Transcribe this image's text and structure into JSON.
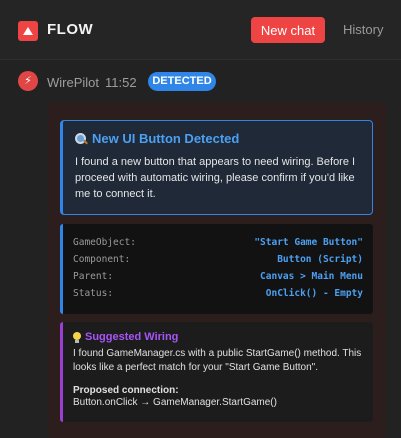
{
  "header": {
    "app_title": "FLOW",
    "new_chat_label": "New chat",
    "history_label": "History",
    "accent_color": "#ef4444"
  },
  "message": {
    "sender": "WirePilot",
    "time": "11:52",
    "badge": "DETECTED",
    "avatar_icon": "lightning-icon",
    "avatar_glyph": "⚡"
  },
  "detect_card": {
    "icon": "search-icon",
    "title": "New UI Button Detected",
    "body": "I found a new button that appears to need wiring. Before I proceed with automatic wiring, please confirm if you'd like me to connect it."
  },
  "details": [
    {
      "key": "GameObject:",
      "value": "\"Start Game Button\""
    },
    {
      "key": "Component:",
      "value": "Button (Script)"
    },
    {
      "key": "Parent:",
      "value": "Canvas > Main Menu"
    },
    {
      "key": "Status:",
      "value": "OnClick() - Empty"
    }
  ],
  "suggestion": {
    "icon": "lightbulb-icon",
    "title": "Suggested Wiring",
    "body": "I found GameManager.cs with a public StartGame() method. This looks like a perfect match for your \"Start Game Button\".",
    "proposed_label": "Proposed connection:",
    "proposed_value": "Button.onClick → GameManager.StartGame()"
  }
}
